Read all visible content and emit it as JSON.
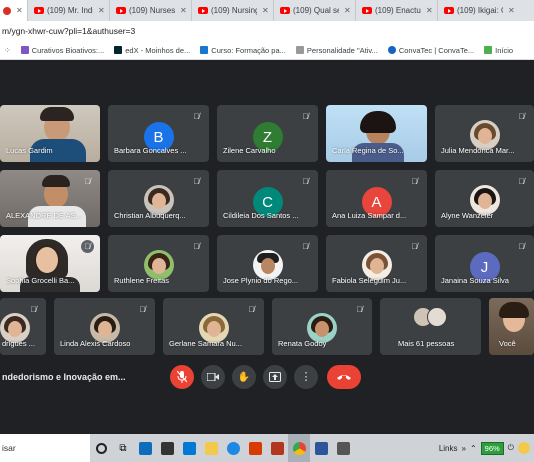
{
  "browser": {
    "tabs": [
      {
        "title": "(109) Mr. Indi"
      },
      {
        "title": "(109) Nurses"
      },
      {
        "title": "(109) Nursing"
      },
      {
        "title": "(109) Qual se"
      },
      {
        "title": "(109) Enactus"
      },
      {
        "title": "(109) Ikigai: O"
      }
    ],
    "address": "m/ygn-xhwr-cuw?pli=1&authuser=3",
    "bookmarks": [
      {
        "label": "Curativos Bioativos:...",
        "color": "#7e57c2"
      },
      {
        "label": "edX - Moinhos de...",
        "color": "#02262b"
      },
      {
        "label": "Curso: Formação pa...",
        "color": "#1976d2"
      },
      {
        "label": "Personalidade \"Ativ...",
        "color": "#999999"
      },
      {
        "label": "ConvaTec | ConvaTe...",
        "color": "#1565c0"
      },
      {
        "label": "Início",
        "color": "#4caf50"
      }
    ]
  },
  "meet": {
    "participants": [
      {
        "name": "Lucas Gardim"
      },
      {
        "name": "Barbara Goncalves ...",
        "initial": "B",
        "color": "#1a73e8"
      },
      {
        "name": "Zilene Carvalho",
        "initial": "Z",
        "color": "#2e7d32"
      },
      {
        "name": "Carla Regina de So..."
      },
      {
        "name": "Julia Mendonca Mar..."
      },
      {
        "name": "ALEXANDRE DE AS..."
      },
      {
        "name": "Christian Albuquerq..."
      },
      {
        "name": "Cildileia Dos Santos ...",
        "initial": "C",
        "color": "#00897b"
      },
      {
        "name": "Ana Luiza Sampar d...",
        "initial": "A",
        "color": "#e8453c"
      },
      {
        "name": "Alyne Wanzeler"
      },
      {
        "name": "Sophia Grocelli Ba..."
      },
      {
        "name": "Ruthlene Freitas"
      },
      {
        "name": "Jose Plynio do Rego..."
      },
      {
        "name": "Fabiola Seleguim Ju..."
      },
      {
        "name": "Janaina Souza Silva",
        "initial": "J",
        "color": "#5c6bc0"
      },
      {
        "name": "drigues ..."
      },
      {
        "name": "Linda Alexis Cardoso"
      },
      {
        "name": "Gerlane Samara Nu..."
      },
      {
        "name": "Renata Godoy"
      },
      {
        "name": "Mais 61 pessoas"
      },
      {
        "name": "Você"
      }
    ],
    "meeting_title": "ndedorismo e Inovação em..."
  },
  "taskbar": {
    "search_text": "isar",
    "links_label": "Links",
    "battery": "96%"
  }
}
